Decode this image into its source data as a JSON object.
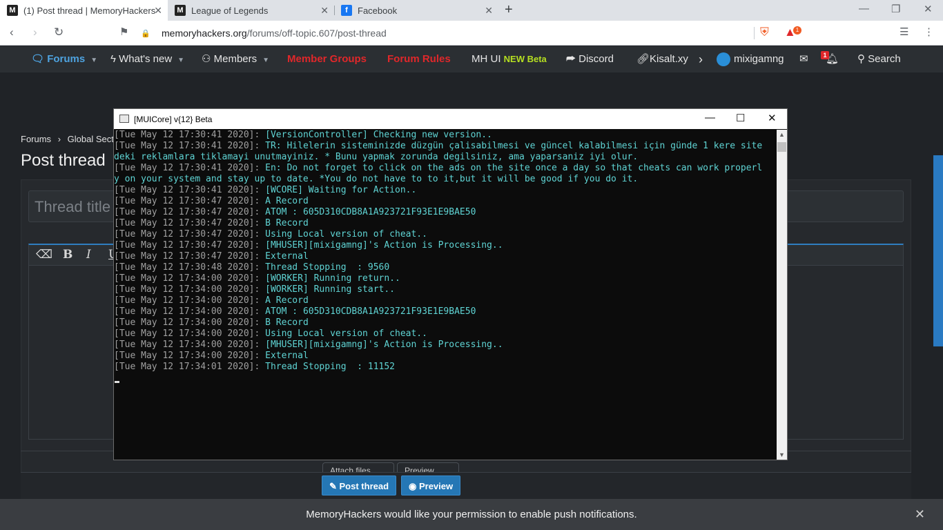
{
  "browser": {
    "tabs": [
      {
        "title": "(1) Post thread | MemoryHackers",
        "icon": "memoryhackers-icon"
      },
      {
        "title": "League of Legends",
        "icon": "memoryhackers-icon"
      },
      {
        "title": "Facebook",
        "icon": "facebook-icon"
      }
    ],
    "url_host": "memoryhackers.org",
    "url_path": "/forums/off-topic.607/post-thread",
    "notification_count": "1"
  },
  "forum_nav": {
    "forums": "Forums",
    "whats_new": "What's new",
    "members": "Members",
    "member_groups": "Member Groups",
    "forum_rules": "Forum Rules",
    "mh_ui": "MH UI",
    "mh_ui_new": "NEW Beta",
    "discord": "Discord",
    "kisalt": "Kisalt.xy",
    "username": "mixigamng",
    "alerts_count": "1",
    "search": "Search"
  },
  "page": {
    "breadcrumb_forums": "Forums",
    "breadcrumb_section": "Global Secti",
    "title": "Post thread",
    "thread_title_placeholder": "Thread title",
    "attach_files": "Attach files",
    "preview_small": "Preview",
    "post_thread_button": "Post thread",
    "preview_button": "Preview"
  },
  "push_notice": "MemoryHackers would like your permission to enable push notifications.",
  "console": {
    "title": "[MUICore] v{12} Beta",
    "lines": [
      {
        "ts": "[Tue May 12 17:30:41 2020]:",
        "msg": " [VersionController] Checking new version.."
      },
      {
        "ts": "[Tue May 12 17:30:41 2020]:",
        "msg": " TR: Hilelerin sisteminizde düzgün çalisabilmesi ve güncel kalabilmesi için günde 1 kere site"
      },
      {
        "ts": "",
        "msg": "deki reklamlara tiklamayi unutmayiniz. * Bunu yapmak zorunda degilsiniz, ama yaparsaniz iyi olur."
      },
      {
        "ts": "[Tue May 12 17:30:41 2020]:",
        "msg": " En: Do not forget to click on the ads on the site once a day so that cheats can work properl"
      },
      {
        "ts": "",
        "msg": "y on your system and stay up to date. *You do not have to to it,but it will be good if you do it."
      },
      {
        "ts": "[Tue May 12 17:30:41 2020]:",
        "msg": " [WCORE] Waiting for Action.."
      },
      {
        "ts": "[Tue May 12 17:30:47 2020]:",
        "msg": " A Record"
      },
      {
        "ts": "[Tue May 12 17:30:47 2020]:",
        "msg": " ATOM : 605D310CDB8A1A923721F93E1E9BAE50"
      },
      {
        "ts": "[Tue May 12 17:30:47 2020]:",
        "msg": " B Record"
      },
      {
        "ts": "[Tue May 12 17:30:47 2020]:",
        "msg": " Using Local version of cheat.."
      },
      {
        "ts": "[Tue May 12 17:30:47 2020]:",
        "msg": " [MHUSER][mixigamng]'s Action is Processing.."
      },
      {
        "ts": "[Tue May 12 17:30:47 2020]:",
        "msg": " External"
      },
      {
        "ts": "[Tue May 12 17:30:48 2020]:",
        "msg": " Thread Stopping  : 9560"
      },
      {
        "ts": "[Tue May 12 17:34:00 2020]:",
        "msg": " [WORKER] Running return.."
      },
      {
        "ts": "[Tue May 12 17:34:00 2020]:",
        "msg": " [WORKER] Running start.."
      },
      {
        "ts": "[Tue May 12 17:34:00 2020]:",
        "msg": " A Record"
      },
      {
        "ts": "[Tue May 12 17:34:00 2020]:",
        "msg": " ATOM : 605D310CDB8A1A923721F93E1E9BAE50"
      },
      {
        "ts": "[Tue May 12 17:34:00 2020]:",
        "msg": " B Record"
      },
      {
        "ts": "[Tue May 12 17:34:00 2020]:",
        "msg": " Using Local version of cheat.."
      },
      {
        "ts": "[Tue May 12 17:34:00 2020]:",
        "msg": " [MHUSER][mixigamng]'s Action is Processing.."
      },
      {
        "ts": "[Tue May 12 17:34:00 2020]:",
        "msg": " External"
      },
      {
        "ts": "[Tue May 12 17:34:01 2020]:",
        "msg": " Thread Stopping  : 11152"
      }
    ]
  }
}
